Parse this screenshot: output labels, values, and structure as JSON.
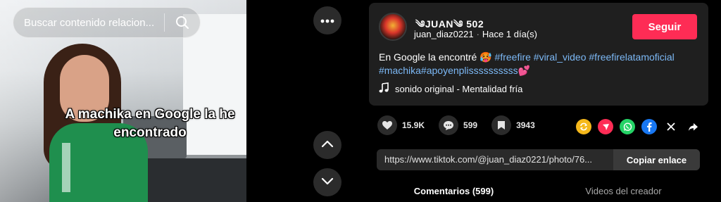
{
  "search": {
    "placeholder": "Buscar contenido relacion..."
  },
  "video": {
    "caption": "A machika en Google la he encontrado"
  },
  "post": {
    "username": "༄JUAN༄ 502",
    "handle": "juan_diaz0221",
    "time": "Hace 1 día(s)",
    "follow_label": "Seguir",
    "description_text": "En Google la encontré 🥵",
    "hashtags": [
      "#freefire",
      "#viral_video",
      "#freefirelatamoficial",
      "#machika",
      "#apoyenplissssssssss"
    ],
    "description_end": "💕",
    "sound": "sonido original - Mentalidad fría"
  },
  "stats": {
    "likes": "15.9K",
    "comments": "599",
    "saves": "3943"
  },
  "link": {
    "url": "https://www.tiktok.com/@juan_diaz0221/photo/76...",
    "copy_label": "Copiar enlace"
  },
  "tabs": [
    {
      "label": "Comentarios (599)"
    },
    {
      "label": "Videos del creador"
    }
  ],
  "colors": {
    "accent": "#fe2c55",
    "hashtag": "#7cb8f5",
    "card": "#1f1f1f"
  },
  "share_icons": [
    "repost-icon",
    "send-icon",
    "whatsapp-icon",
    "facebook-icon",
    "x-icon",
    "share-arrow-icon"
  ]
}
